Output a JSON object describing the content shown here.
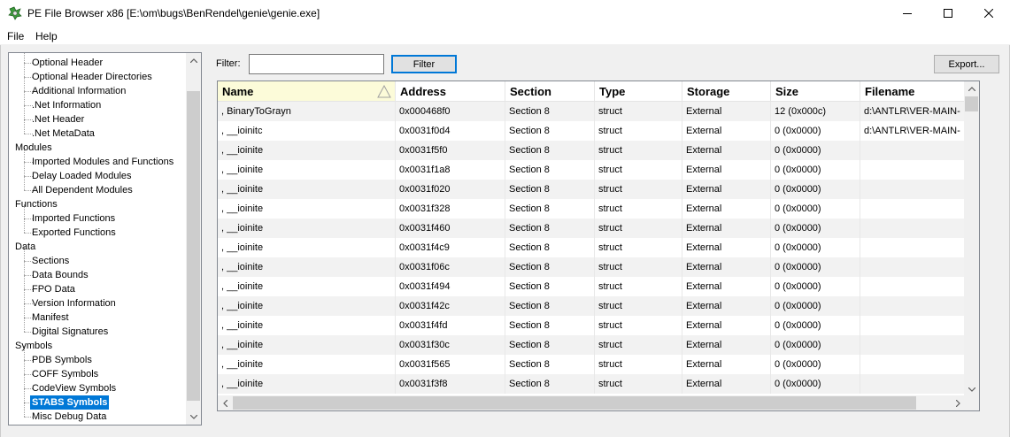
{
  "window": {
    "title": "PE File Browser x86 [E:\\om\\bugs\\BenRendel\\genie\\genie.exe]",
    "app_icon": "pe-browser-icon",
    "accent": "#0078d7"
  },
  "menu": {
    "items": [
      "File",
      "Help"
    ]
  },
  "tree": {
    "items": [
      {
        "label": "Optional Header",
        "level": 1
      },
      {
        "label": "Optional Header Directories",
        "level": 1
      },
      {
        "label": "Additional Information",
        "level": 1
      },
      {
        "label": ".Net Information",
        "level": 1
      },
      {
        "label": ".Net Header",
        "level": 1
      },
      {
        "label": ".Net MetaData",
        "level": 1
      },
      {
        "label": "Modules",
        "level": 0
      },
      {
        "label": "Imported Modules and Functions",
        "level": 1
      },
      {
        "label": "Delay Loaded Modules",
        "level": 1
      },
      {
        "label": "All Dependent Modules",
        "level": 1
      },
      {
        "label": "Functions",
        "level": 0
      },
      {
        "label": "Imported Functions",
        "level": 1
      },
      {
        "label": "Exported Functions",
        "level": 1
      },
      {
        "label": "Data",
        "level": 0
      },
      {
        "label": "Sections",
        "level": 1
      },
      {
        "label": "Data Bounds",
        "level": 1
      },
      {
        "label": "FPO Data",
        "level": 1
      },
      {
        "label": "Version Information",
        "level": 1
      },
      {
        "label": "Manifest",
        "level": 1
      },
      {
        "label": "Digital Signatures",
        "level": 1
      },
      {
        "label": "Symbols",
        "level": 0
      },
      {
        "label": "PDB Symbols",
        "level": 1
      },
      {
        "label": "COFF Symbols",
        "level": 1
      },
      {
        "label": "CodeView Symbols",
        "level": 1
      },
      {
        "label": "STABS Symbols",
        "level": 1,
        "selected": true
      },
      {
        "label": "Misc Debug Data",
        "level": 1
      }
    ]
  },
  "filter": {
    "label": "Filter:",
    "value": "",
    "button_label": "Filter",
    "export_label": "Export..."
  },
  "list": {
    "columns": [
      "Name",
      "Address",
      "Section",
      "Type",
      "Storage",
      "Size",
      "Filename"
    ],
    "sorted_column": "Name",
    "rows": [
      [
        ", BinaryToGrayn",
        "0x000468f0",
        "Section 8",
        "struct",
        "External",
        "12 (0x000c)",
        "d:\\ANTLR\\VER-MAIN-"
      ],
      [
        ", __ioinitc",
        "0x0031f0d4",
        "Section 8",
        "struct",
        "External",
        "0 (0x0000)",
        "d:\\ANTLR\\VER-MAIN-"
      ],
      [
        ", __ioinite",
        "0x0031f5f0",
        "Section 8",
        "struct",
        "External",
        "0 (0x0000)",
        ""
      ],
      [
        ", __ioinite",
        "0x0031f1a8",
        "Section 8",
        "struct",
        "External",
        "0 (0x0000)",
        ""
      ],
      [
        ", __ioinite",
        "0x0031f020",
        "Section 8",
        "struct",
        "External",
        "0 (0x0000)",
        ""
      ],
      [
        ", __ioinite",
        "0x0031f328",
        "Section 8",
        "struct",
        "External",
        "0 (0x0000)",
        ""
      ],
      [
        ", __ioinite",
        "0x0031f460",
        "Section 8",
        "struct",
        "External",
        "0 (0x0000)",
        ""
      ],
      [
        ", __ioinite",
        "0x0031f4c9",
        "Section 8",
        "struct",
        "External",
        "0 (0x0000)",
        ""
      ],
      [
        ", __ioinite",
        "0x0031f06c",
        "Section 8",
        "struct",
        "External",
        "0 (0x0000)",
        ""
      ],
      [
        ", __ioinite",
        "0x0031f494",
        "Section 8",
        "struct",
        "External",
        "0 (0x0000)",
        ""
      ],
      [
        ", __ioinite",
        "0x0031f42c",
        "Section 8",
        "struct",
        "External",
        "0 (0x0000)",
        ""
      ],
      [
        ", __ioinite",
        "0x0031f4fd",
        "Section 8",
        "struct",
        "External",
        "0 (0x0000)",
        ""
      ],
      [
        ", __ioinite",
        "0x0031f30c",
        "Section 8",
        "struct",
        "External",
        "0 (0x0000)",
        ""
      ],
      [
        ", __ioinite",
        "0x0031f565",
        "Section 8",
        "struct",
        "External",
        "0 (0x0000)",
        ""
      ],
      [
        ", __ioinite",
        "0x0031f3f8",
        "Section 8",
        "struct",
        "External",
        "0 (0x0000)",
        ""
      ]
    ]
  }
}
